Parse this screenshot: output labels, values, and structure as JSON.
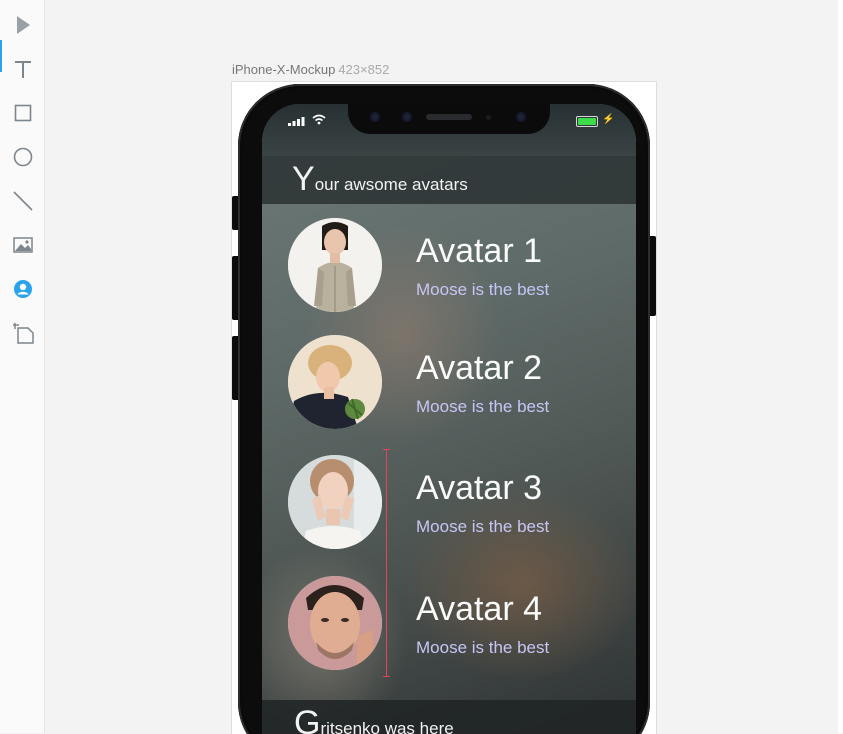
{
  "editor": {
    "tools": [
      {
        "name": "select-tool"
      },
      {
        "name": "text-tool"
      },
      {
        "name": "rectangle-tool"
      },
      {
        "name": "ellipse-tool"
      },
      {
        "name": "line-tool"
      },
      {
        "name": "image-tool"
      },
      {
        "name": "avatar-tool"
      },
      {
        "name": "artboard-tool"
      }
    ],
    "active_tool": "text-tool",
    "accent_color": "#2ba3ec",
    "guide_color": "#e0465a"
  },
  "artboard": {
    "name": "iPhone-X-Mockup",
    "dimensions": "423×852"
  },
  "app": {
    "header": {
      "initial": "Y",
      "rest": "our awsome avatars"
    },
    "avatars": [
      {
        "name": "Avatar 1",
        "subtitle": "Moose is the best"
      },
      {
        "name": "Avatar 2",
        "subtitle": "Moose is the best"
      },
      {
        "name": "Avatar 3",
        "subtitle": "Moose is the best"
      },
      {
        "name": "Avatar 4",
        "subtitle": "Moose is the best"
      }
    ],
    "footer": {
      "initial": "G",
      "rest": "ritsenko was here"
    },
    "subtitle_color": "#c6c6f6",
    "battery_color": "#3ddc4a"
  }
}
